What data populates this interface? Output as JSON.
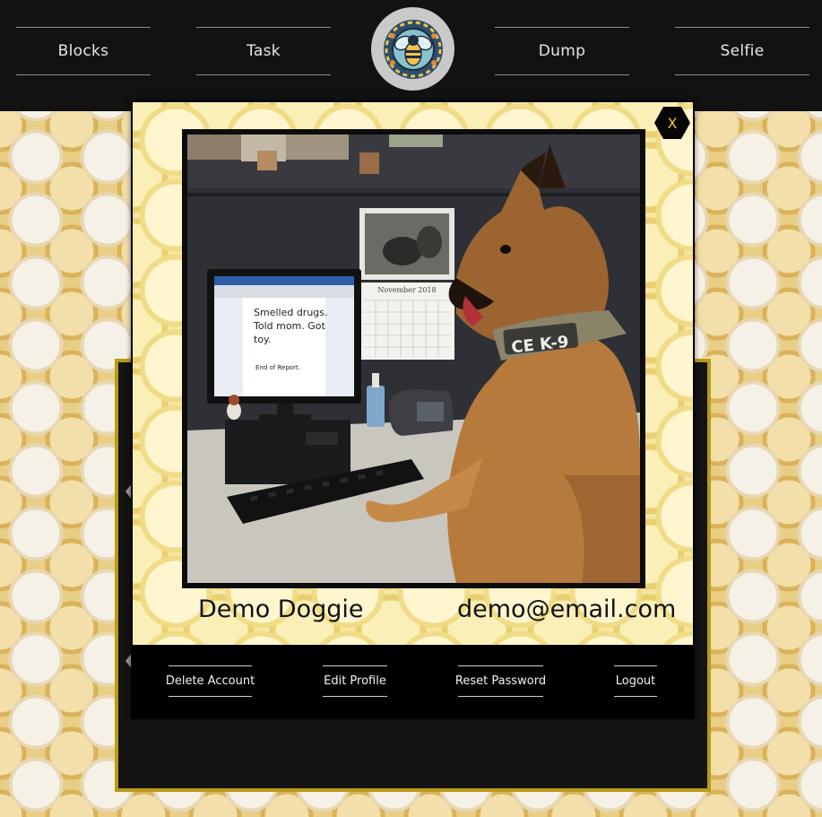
{
  "nav": {
    "items": [
      {
        "label": "Blocks"
      },
      {
        "label": "Task"
      },
      {
        "label": "Dump"
      },
      {
        "label": "Selfie"
      }
    ]
  },
  "modal": {
    "close_label": "X",
    "photo": {
      "note_lines": [
        "Smelled drugs.",
        "Told mom.  Got",
        "toy."
      ],
      "note_footer": "End of Report.",
      "calendar_month": "November 2018",
      "collar_text": "CE K-9"
    },
    "profile": {
      "name": "Demo Doggie",
      "email": "demo@email.com"
    },
    "actions": {
      "delete": "Delete Account",
      "edit": "Edit Profile",
      "reset": "Reset Password",
      "logout": "Logout"
    }
  },
  "colors": {
    "nav_bg": "#121212",
    "accent_gold": "#f2c230",
    "panel_border": "#b99b1a"
  }
}
